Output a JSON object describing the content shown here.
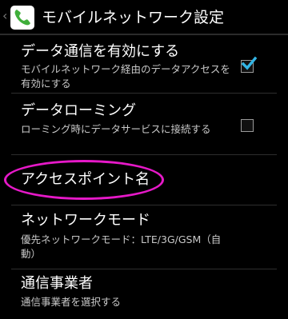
{
  "header": {
    "title": "モバイルネットワーク設定",
    "icon": "phone-icon",
    "accent_color": "#3fae3a"
  },
  "preferences": [
    {
      "title": "データ通信を有効にする",
      "summary": "モバイルネットワーク経由のデータアクセスを有効にする",
      "checkbox": true,
      "checked": true
    },
    {
      "title": "データローミング",
      "summary": "ローミング時にデータサービスに接続する",
      "checkbox": true,
      "checked": false
    },
    {
      "title": "アクセスポイント名",
      "highlighted": true,
      "highlight_color": "#e619c8"
    },
    {
      "title": "ネットワークモード",
      "summary": "優先ネットワークモード：LTE/3G/GSM（自動）"
    },
    {
      "title": "通信事業者",
      "summary": "通信事業者を選択する"
    }
  ],
  "checkmark_color": "#33b5e5"
}
